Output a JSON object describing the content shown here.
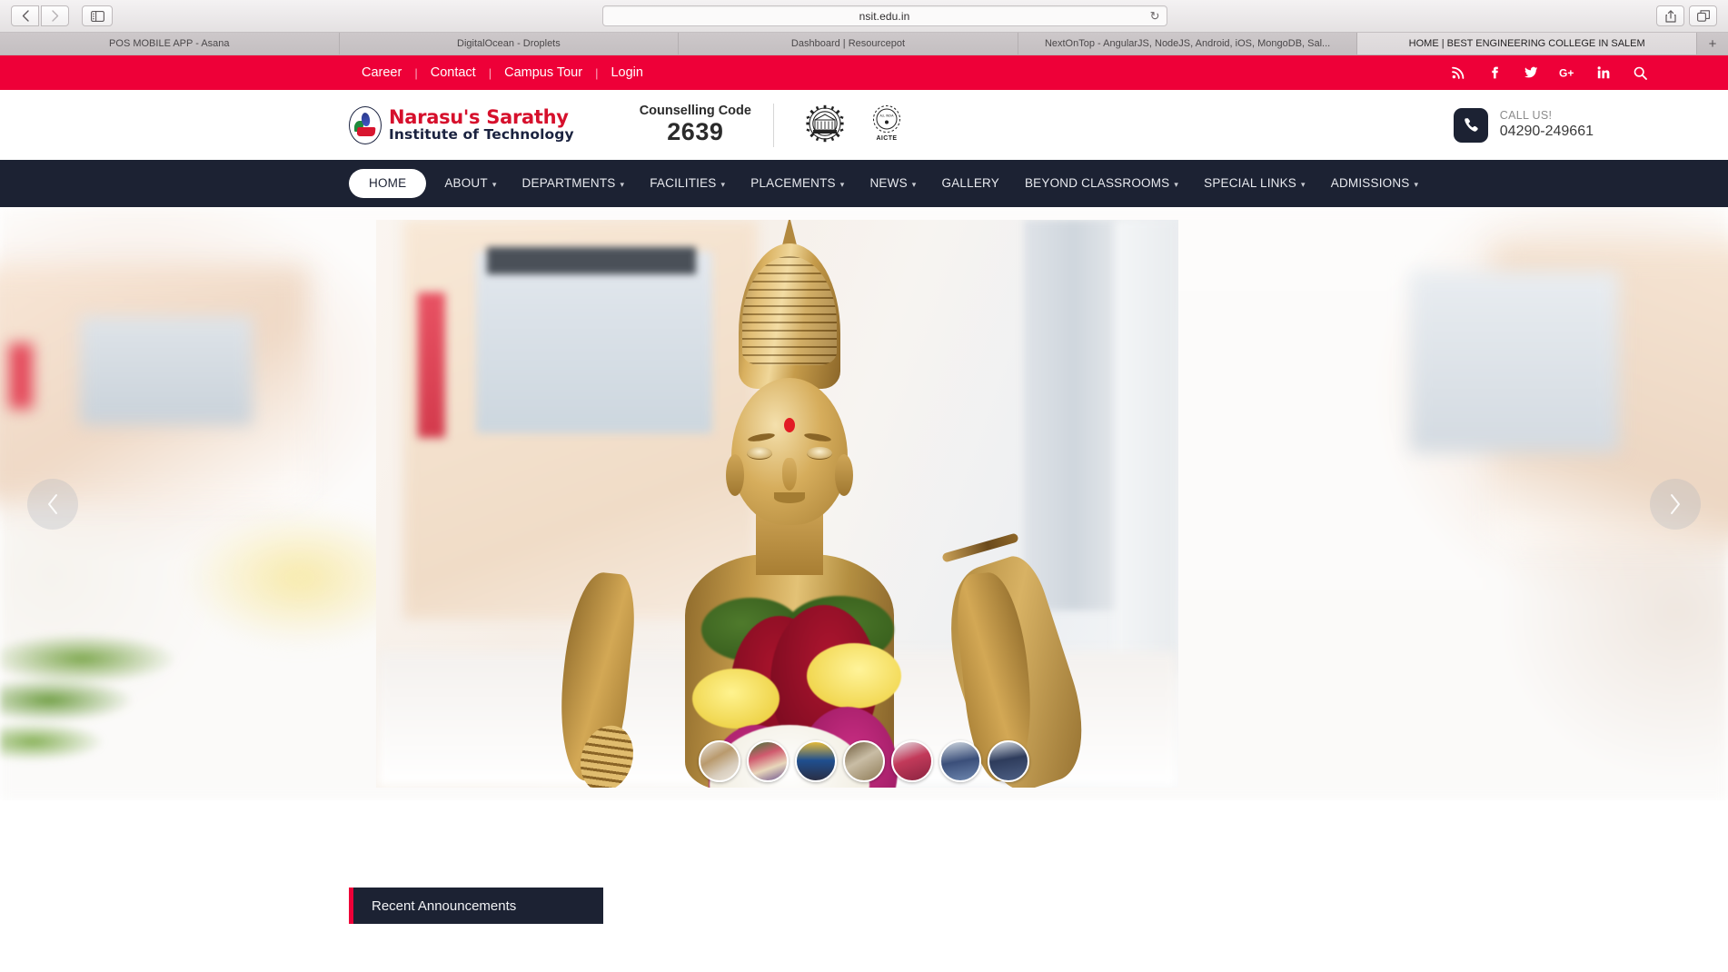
{
  "browser": {
    "url": "nsit.edu.in",
    "back_icon": "chevron-left-icon",
    "forward_icon": "chevron-right-icon",
    "sidebar_icon": "sidebar-toggle-icon",
    "reload_icon": "reload-icon",
    "share_icon": "share-icon",
    "tabs_overview_icon": "tab-overview-icon",
    "new_tab_label": "+",
    "tabs": [
      {
        "title": "POS MOBILE APP - Asana",
        "active": false
      },
      {
        "title": "DigitalOcean - Droplets",
        "active": false
      },
      {
        "title": "Dashboard | Resourcepot",
        "active": false
      },
      {
        "title": "NextOnTop - AngularJS, NodeJS, Android, iOS, MongoDB, Sal...",
        "active": false
      },
      {
        "title": "HOME | BEST ENGINEERING COLLEGE IN SALEM",
        "active": true
      }
    ]
  },
  "topbar": {
    "background": "#ee0038",
    "links": [
      "Career",
      "Contact",
      "Campus Tour",
      "Login"
    ],
    "separator": "|",
    "social": [
      {
        "name": "rss-icon",
        "label": "RSS"
      },
      {
        "name": "facebook-icon",
        "label": "f"
      },
      {
        "name": "twitter-icon",
        "label": "Twitter"
      },
      {
        "name": "google-plus-icon",
        "label": "G+"
      },
      {
        "name": "linkedin-icon",
        "label": "in"
      },
      {
        "name": "search-icon",
        "label": "Search"
      }
    ]
  },
  "header": {
    "logo": {
      "line1": "Narasu's Sarathy",
      "line2": "Institute of Technology",
      "line1_color": "#d6102c",
      "line2_color": "#1b2340"
    },
    "counselling": {
      "label": "Counselling Code",
      "code": "2639"
    },
    "accreditations": [
      {
        "name": "anna-university-logo",
        "label": ""
      },
      {
        "name": "aicte-logo",
        "label": "AICTE"
      }
    ],
    "call": {
      "icon": "phone-icon",
      "label": "CALL US!",
      "number": "04290-249661"
    }
  },
  "nav": {
    "background": "#1c2233",
    "items": [
      {
        "label": "HOME",
        "active": true,
        "caret": false
      },
      {
        "label": "ABOUT",
        "active": false,
        "caret": true
      },
      {
        "label": "DEPARTMENTS",
        "active": false,
        "caret": true
      },
      {
        "label": "FACILITIES",
        "active": false,
        "caret": true
      },
      {
        "label": "PLACEMENTS",
        "active": false,
        "caret": true
      },
      {
        "label": "NEWS",
        "active": false,
        "caret": true
      },
      {
        "label": "GALLERY",
        "active": false,
        "caret": false
      },
      {
        "label": "BEYOND CLASSROOMS",
        "active": false,
        "caret": true
      },
      {
        "label": "SPECIAL LINKS",
        "active": false,
        "caret": true
      },
      {
        "label": "ADMISSIONS",
        "active": false,
        "caret": true
      }
    ]
  },
  "hero": {
    "prev_icon": "chevron-left-icon",
    "next_icon": "chevron-right-icon",
    "image_alt": "Brass Saraswati statue decorated with flower garlands",
    "thumbnails": [
      {
        "name": "thumb-statue"
      },
      {
        "name": "thumb-group-photo"
      },
      {
        "name": "thumb-campus-building"
      },
      {
        "name": "thumb-auditorium"
      },
      {
        "name": "thumb-students"
      },
      {
        "name": "thumb-assembly"
      },
      {
        "name": "thumb-hall"
      }
    ]
  },
  "announcements": {
    "title": "Recent Announcements",
    "accent_color": "#ee0038",
    "background": "#1c2233"
  }
}
